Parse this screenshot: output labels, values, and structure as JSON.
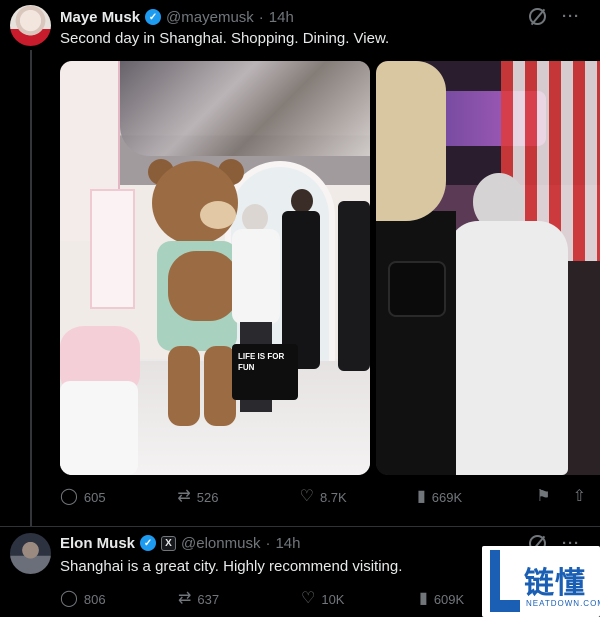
{
  "tweets": [
    {
      "name": "Maye Musk",
      "handle": "@mayemusk",
      "dot": "·",
      "time": "14h",
      "text": "Second day in Shanghai. Shopping. Dining. View.",
      "bag_text": "LIFE IS FOR FUN",
      "stats": {
        "replies": "605",
        "reposts": "526",
        "likes": "8.7K",
        "views": "669K"
      }
    },
    {
      "name": "Elon Musk",
      "affiliate_badge": "X",
      "handle": "@elonmusk",
      "dot": "·",
      "time": "14h",
      "text": "Shanghai is a great city. Highly recommend visiting.",
      "stats": {
        "replies": "806",
        "reposts": "637",
        "likes": "10K",
        "views": "609K"
      }
    }
  ],
  "icons": {
    "more": "···",
    "verified": "✓",
    "reply": "◯",
    "repost": "⇄",
    "like": "♡",
    "views": "▮",
    "bookmark": "⚑",
    "share": "⇧"
  },
  "watermark": {
    "cn": "链懂",
    "en": "NEATDOWN.COM"
  },
  "colors": {
    "accent": "#1d9bf0",
    "muted": "#71767b",
    "text": "#e7e9ea",
    "background": "#000000",
    "watermark": "#1a5fb4"
  }
}
